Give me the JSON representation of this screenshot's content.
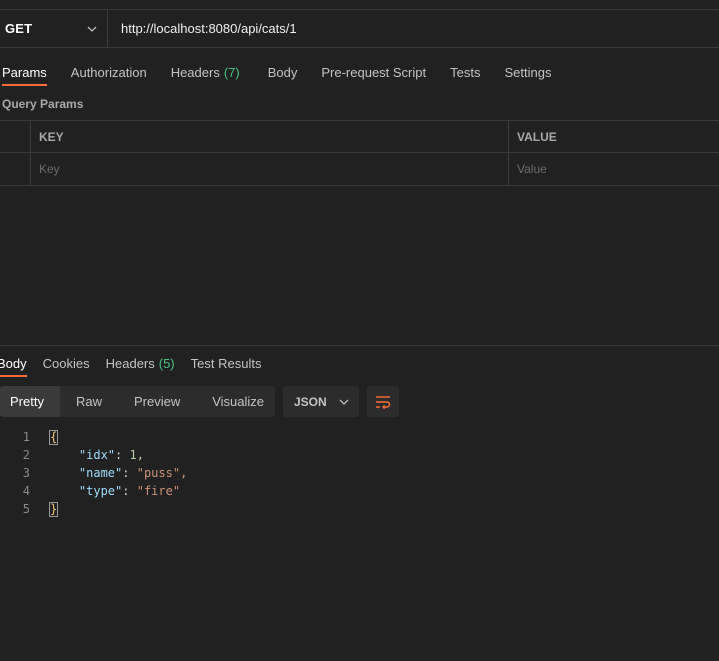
{
  "request": {
    "method": "GET",
    "url": "http://localhost:8080/api/cats/1"
  },
  "request_tabs": [
    {
      "label": "Params",
      "active": true
    },
    {
      "label": "Authorization"
    },
    {
      "label": "Headers",
      "count": "(7)"
    },
    {
      "label": "Body"
    },
    {
      "label": "Pre-request Script"
    },
    {
      "label": "Tests"
    },
    {
      "label": "Settings"
    }
  ],
  "query_params": {
    "title": "Query Params",
    "headers": {
      "key": "KEY",
      "value": "VALUE"
    },
    "placeholders": {
      "key": "Key",
      "value": "Value"
    }
  },
  "response_tabs": [
    {
      "label": "Body",
      "active": true
    },
    {
      "label": "Cookies"
    },
    {
      "label": "Headers",
      "count": "(5)"
    },
    {
      "label": "Test Results"
    }
  ],
  "format_buttons": [
    "Pretty",
    "Raw",
    "Preview",
    "Visualize"
  ],
  "language": "JSON",
  "code_lines": [
    {
      "num": "1",
      "text": "{"
    },
    {
      "num": "2",
      "key": "\"idx\"",
      "value": "1,"
    },
    {
      "num": "3",
      "key": "\"name\"",
      "value": "\"puss\","
    },
    {
      "num": "4",
      "key": "\"type\"",
      "value": "\"fire\""
    },
    {
      "num": "5",
      "text": "}"
    }
  ],
  "colors": {
    "accent": "#ff6c37",
    "count_green": "#49c480",
    "background": "#212121"
  },
  "icons": [
    "chevron-down-icon",
    "word-wrap-icon"
  ]
}
